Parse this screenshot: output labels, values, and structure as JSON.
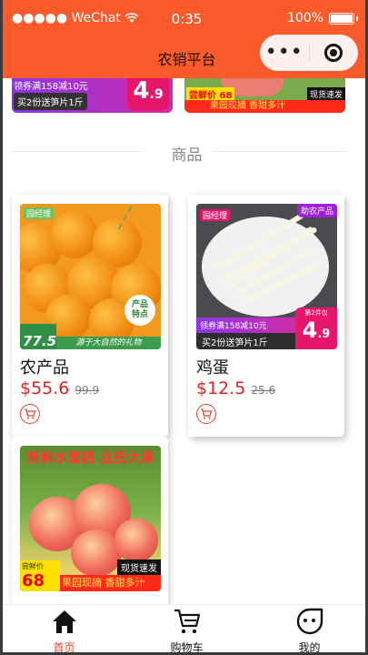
{
  "status_bar": {
    "carrier": "●●●●● WeChat",
    "time": "0:35",
    "battery": "100%"
  },
  "navbar": {
    "title": "农销平台"
  },
  "top_promos": {
    "left": {
      "coupon": "领券满158减10元",
      "buy": "买2份送笋片1斤",
      "price_int": "4",
      "price_dec": ".9"
    },
    "right": {
      "limited": "尝鲜价",
      "price": "68",
      "fast": "现货速发",
      "strip": "果园现摘 香甜多汁"
    }
  },
  "section": {
    "title": "商品"
  },
  "products": [
    {
      "name": "农产品",
      "price": "$55.6",
      "old_price": "99.9",
      "img": {
        "tag": "园经理",
        "badge": "产品\n特点",
        "price_tag": "77.5",
        "slogan": "源于大自然的礼物"
      }
    },
    {
      "name": "鸡蛋",
      "price": "$12.5",
      "old_price": "25.6",
      "img": {
        "tag": "园经理",
        "help": "助农产品",
        "coupon": "领券满158减10元",
        "buy": "买2份送笋片1斤",
        "cap": "第2件仅",
        "price_int": "4",
        "price_dec": ".9"
      }
    },
    {
      "name": "",
      "price": "",
      "old_price": "",
      "img": {
        "head": "新鲜水蜜桃 品质大果",
        "limited": "尝鲜价",
        "price": "68",
        "fast": "现货速发",
        "strip": "果园现摘 香甜多汁"
      }
    }
  ],
  "tabbar": [
    {
      "label": "首页",
      "icon": "home-icon",
      "active": true
    },
    {
      "label": "购物车",
      "icon": "cart-icon",
      "active": false
    },
    {
      "label": "我的",
      "icon": "profile-icon",
      "active": false
    }
  ],
  "colors": {
    "header": "#fb5a2a",
    "accent": "#e02020",
    "tab_active": "#e8402a"
  }
}
